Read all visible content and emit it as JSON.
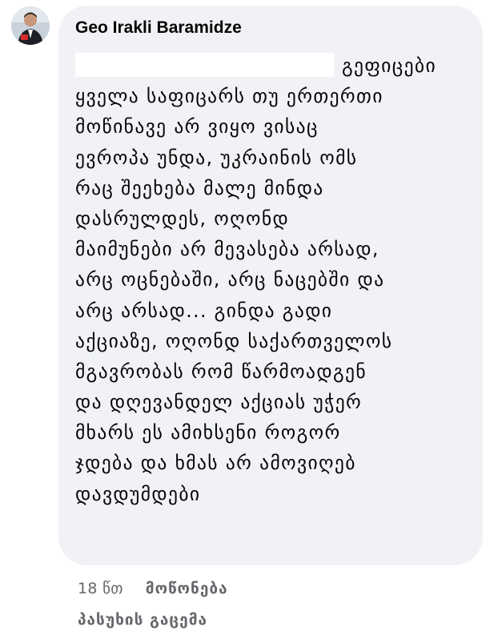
{
  "comment": {
    "author": "Geo Irakli Baramidze",
    "text_lines": [
      "გეფიცები",
      "ყველა საფიცარს თუ ერთერთი",
      "მოწინავე არ ვიყო ვისაც",
      "ევროპა უნდა, უკრაინის ომს",
      "რაც შეეხება მალე მინდა",
      "დასრულდეს, ოღონდ",
      "მაიმუნები არ მევასება არსად,",
      "არც ოცნებაში, არც ნაცებში და",
      "არც არსად... გინდა გადი",
      "აქციაზე, ოღონდ საქართველოს",
      "მგავრობას რომ წარმოადგენ",
      "და დღევანდელ აქციას უჭერ",
      "მხარს ეს ამიხსენი როგორ",
      "ჯდება და ხმას არ ამოვიღებ",
      "დავდუმდები"
    ],
    "time": "18 წთ",
    "like_label": "მოწონება",
    "reply_label": "პასუხის გაცემა"
  },
  "colors": {
    "bubble_bg": "#f0f2f5",
    "text": "#050505",
    "meta": "#65676b"
  }
}
